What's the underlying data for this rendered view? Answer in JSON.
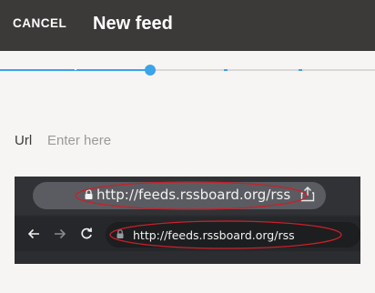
{
  "app_bar": {
    "cancel_label": "CANCEL",
    "title": "New feed"
  },
  "stepper": {
    "active_step": 3,
    "steps": 5
  },
  "form": {
    "url_label": "Url",
    "url_placeholder": "Enter here",
    "url_value": ""
  },
  "hint": {
    "url_example_top": "http://feeds.rssboard.org/rss",
    "url_example_bottom": "http://feeds.rssboard.org/rss"
  },
  "colors": {
    "app_bar": "#3b3a38",
    "accent": "#3ba4e8",
    "background": "#f6f5f3",
    "highlight_ellipse": "#c8202a"
  },
  "icons": [
    "lock-icon",
    "share-icon",
    "back-arrow-icon",
    "forward-arrow-icon",
    "reload-icon"
  ]
}
